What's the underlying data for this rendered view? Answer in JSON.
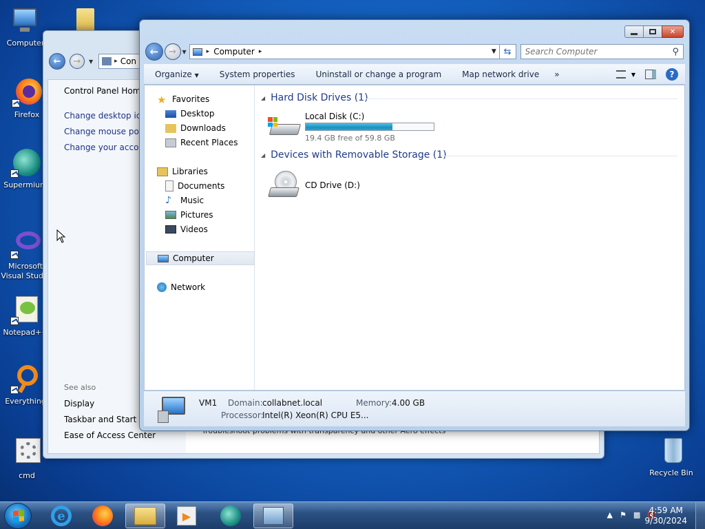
{
  "desktop": {
    "icons": [
      {
        "label": "Computer"
      },
      {
        "label": ""
      },
      {
        "label": "Firefox"
      },
      {
        "label": "Supermium"
      },
      {
        "label": "Microsoft Visual Studio"
      },
      {
        "label": "Notepad++"
      },
      {
        "label": "Everything"
      },
      {
        "label": "cmd"
      },
      {
        "label": "Recycle Bin"
      }
    ]
  },
  "control_panel": {
    "address": "Con",
    "links": [
      "Control Panel Home",
      "Change desktop ico",
      "Change mouse poin",
      "Change your accou"
    ],
    "see_also_header": "See also",
    "see_also": [
      "Display",
      "Taskbar and Start M",
      "Ease of Access Center"
    ],
    "bottom_text": "Troubleshoot problems with transparency and other Aero effects"
  },
  "explorer": {
    "address": "Computer",
    "search_placeholder": "Search Computer",
    "toolbar": {
      "organize": "Organize",
      "system_properties": "System properties",
      "uninstall": "Uninstall or change a program",
      "map_network": "Map network drive",
      "more": "»"
    },
    "nav": {
      "favorites": "Favorites",
      "desktop": "Desktop",
      "downloads": "Downloads",
      "recent_places": "Recent Places",
      "libraries": "Libraries",
      "documents": "Documents",
      "music": "Music",
      "pictures": "Pictures",
      "videos": "Videos",
      "computer": "Computer",
      "network": "Network"
    },
    "groups": {
      "hdd_header": "Hard Disk Drives (1)",
      "removable_header": "Devices with Removable Storage (1)"
    },
    "local_disk": {
      "name": "Local Disk (C:)",
      "free_text": "19.4 GB free of 59.8 GB",
      "used_fraction": 0.676
    },
    "cd_drive": {
      "name": "CD Drive (D:)"
    },
    "details": {
      "name": "VM1",
      "domain_label": "Domain:",
      "domain_value": "collabnet.local",
      "memory_label": "Memory:",
      "memory_value": "4.00 GB",
      "processor_label": "Processor:",
      "processor_value": "Intel(R) Xeon(R) CPU E5..."
    }
  },
  "taskbar": {
    "time": "4:59 AM",
    "date": "9/30/2024"
  },
  "colors": {
    "accent": "#1e3a8a",
    "link": "#1e3287",
    "progress": "#1a8fc0"
  }
}
